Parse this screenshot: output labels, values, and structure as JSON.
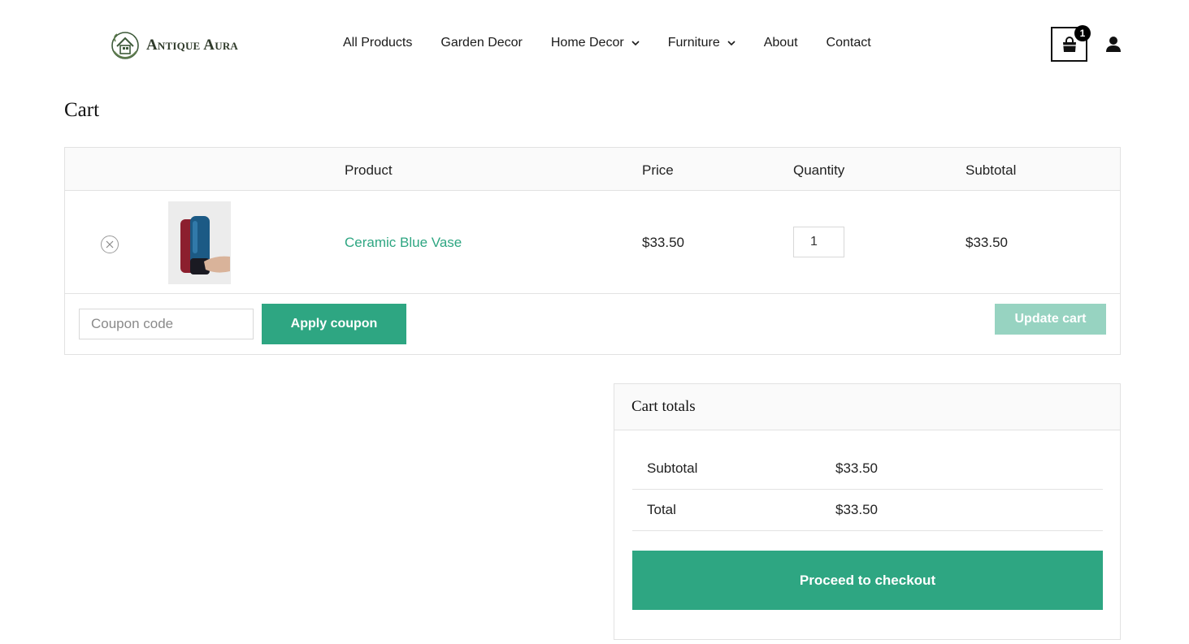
{
  "brand": {
    "name": "Antique Aura"
  },
  "nav": {
    "items": [
      {
        "label": "All Products"
      },
      {
        "label": "Garden Decor"
      },
      {
        "label": "Home Decor"
      },
      {
        "label": "Furniture"
      },
      {
        "label": "About"
      },
      {
        "label": "Contact"
      }
    ],
    "cart_count": "1"
  },
  "page": {
    "title": "Cart"
  },
  "cart": {
    "headers": {
      "product": "Product",
      "price": "Price",
      "quantity": "Quantity",
      "subtotal": "Subtotal"
    },
    "items": [
      {
        "name": "Ceramic Blue Vase",
        "price": "$33.50",
        "quantity": "1",
        "subtotal": "$33.50"
      }
    ],
    "coupon": {
      "placeholder": "Coupon code",
      "apply_label": "Apply coupon"
    },
    "update_label": "Update cart"
  },
  "totals": {
    "title": "Cart totals",
    "subtotal_label": "Subtotal",
    "subtotal_value": "$33.50",
    "total_label": "Total",
    "total_value": "$33.50",
    "checkout_label": "Proceed to checkout"
  },
  "colors": {
    "accent": "#2ea682",
    "accent_disabled": "#97d3c1",
    "text": "#222222"
  },
  "icons": {
    "cart": "shopping-bag-icon",
    "user": "user-icon",
    "remove": "remove-circle-icon",
    "dropdown": "chevron-down-icon"
  }
}
